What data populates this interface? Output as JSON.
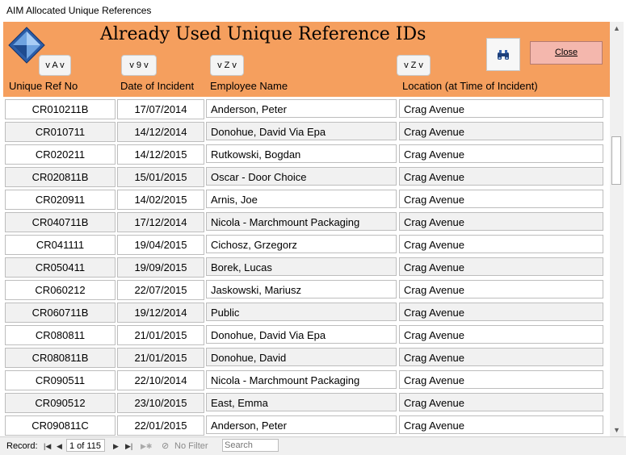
{
  "window": {
    "title": "AIM Allocated Unique References"
  },
  "header": {
    "heading": "Already Used Unique Reference IDs",
    "close_label": "Close",
    "sort_buttons": [
      {
        "label": "v A v"
      },
      {
        "label": "v 9 v"
      },
      {
        "label": "v Z v"
      },
      {
        "label": "v Z v"
      }
    ],
    "columns": {
      "ref": "Unique Ref No",
      "date": "Date of Incident",
      "employee": "Employee Name",
      "location": "Location (at Time of Incident)"
    },
    "accent_color": "#f59f5e"
  },
  "rows": [
    {
      "ref": "CR010211B",
      "date": "17/07/2014",
      "employee": "Anderson, Peter",
      "location": "Crag Avenue"
    },
    {
      "ref": "CR010711",
      "date": "14/12/2014",
      "employee": "Donohue, David Via Epa",
      "location": "Crag Avenue"
    },
    {
      "ref": "CR020211",
      "date": "14/12/2015",
      "employee": "Rutkowski, Bogdan",
      "location": "Crag Avenue"
    },
    {
      "ref": "CR020811B",
      "date": "15/01/2015",
      "employee": "Oscar - Door Choice",
      "location": "Crag Avenue"
    },
    {
      "ref": "CR020911",
      "date": "14/02/2015",
      "employee": "Arnis, Joe",
      "location": "Crag Avenue"
    },
    {
      "ref": "CR040711B",
      "date": "17/12/2014",
      "employee": "Nicola - Marchmount Packaging",
      "location": "Crag Avenue"
    },
    {
      "ref": "CR041111",
      "date": "19/04/2015",
      "employee": "Cichosz, Grzegorz",
      "location": "Crag Avenue"
    },
    {
      "ref": "CR050411",
      "date": "19/09/2015",
      "employee": "Borek, Lucas",
      "location": "Crag Avenue"
    },
    {
      "ref": "CR060212",
      "date": "22/07/2015",
      "employee": "Jaskowski, Mariusz",
      "location": "Crag Avenue"
    },
    {
      "ref": "CR060711B",
      "date": "19/12/2014",
      "employee": "Public",
      "location": "Crag Avenue"
    },
    {
      "ref": "CR080811",
      "date": "21/01/2015",
      "employee": "Donohue, David Via Epa",
      "location": "Crag Avenue"
    },
    {
      "ref": "CR080811B",
      "date": "21/01/2015",
      "employee": "Donohue, David",
      "location": "Crag Avenue"
    },
    {
      "ref": "CR090511",
      "date": "22/10/2014",
      "employee": "Nicola - Marchmount Packaging",
      "location": "Crag Avenue"
    },
    {
      "ref": "CR090512",
      "date": "23/10/2015",
      "employee": "East, Emma",
      "location": "Crag Avenue"
    },
    {
      "ref": "CR090811C",
      "date": "22/01/2015",
      "employee": "Anderson, Peter",
      "location": "Crag Avenue"
    }
  ],
  "navigation": {
    "record_label": "Record:",
    "record_position": "1 of 115",
    "filter_label": "No Filter",
    "search_placeholder": "Search"
  },
  "icons": {
    "find": "binoculars-icon",
    "logo": "diamond-logo-icon",
    "first": "first-record-icon",
    "prev": "previous-record-icon",
    "next": "next-record-icon",
    "last": "last-record-icon",
    "new": "new-record-icon",
    "filter": "no-filter-icon"
  }
}
